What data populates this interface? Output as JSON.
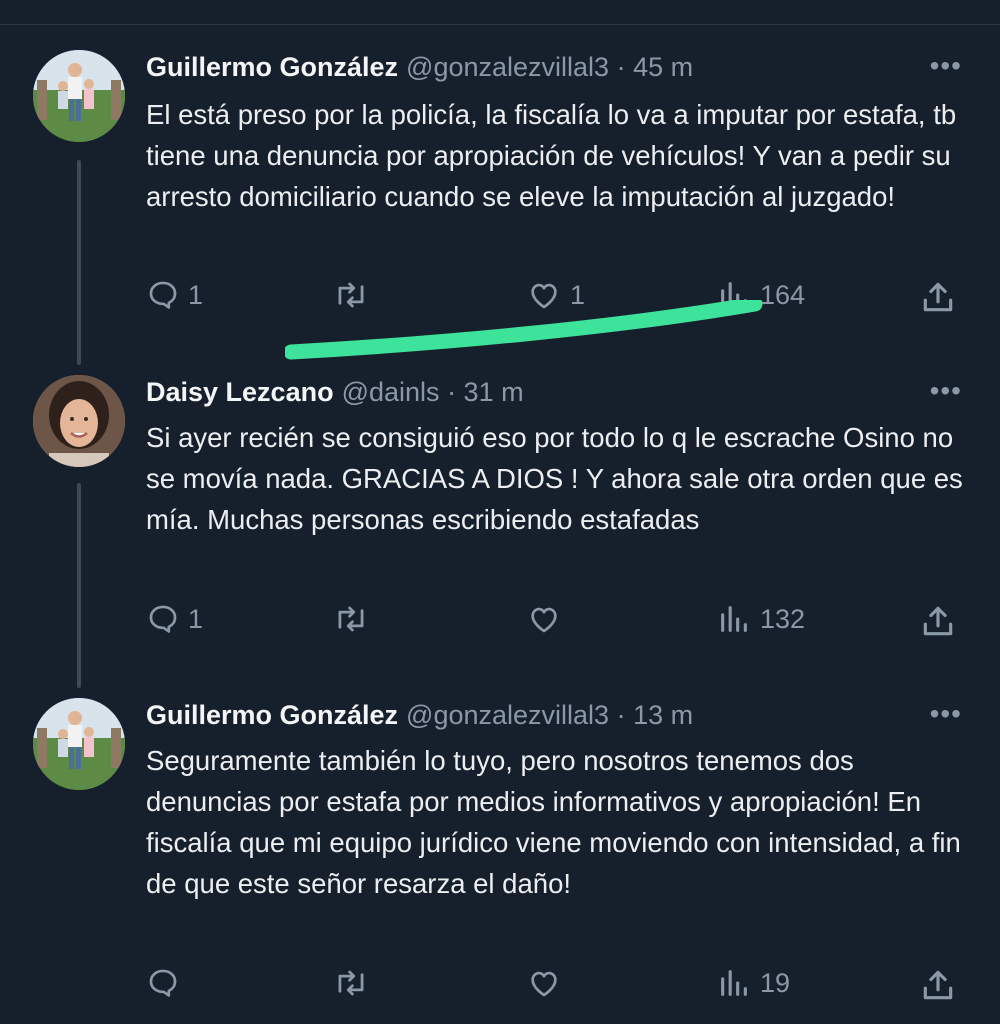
{
  "tweets": [
    {
      "author": "Guillermo González",
      "handle": "@gonzalezvillal3",
      "time": "· 45 m",
      "text": "El está preso por la policía, la fiscalía lo va a imputar por estafa, tb tiene una denuncia por apropiación de vehículos! Y van a pedir su arresto domiciliario cuando se eleve la imputación al juzgado!",
      "replies": "1",
      "retweets": "",
      "likes": "1",
      "views": "164"
    },
    {
      "author": "Daisy Lezcano",
      "handle": "@dainls",
      "time": "· 31 m",
      "text": "Si ayer recién se consiguió eso por todo lo q le escrache Osino no se movía nada. GRACIAS A DIOS ! Y ahora sale otra orden que es mía. Muchas personas escribiendo estafadas",
      "replies": "1",
      "retweets": "",
      "likes": "",
      "views": "132"
    },
    {
      "author": "Guillermo González",
      "handle": "@gonzalezvillal3",
      "time": "· 13 m",
      "text": "Seguramente también lo tuyo, pero nosotros tenemos dos denuncias por estafa por medios informativos y apropiación! En fiscalía que mi equipo jurídico viene moviendo con intensidad, a fin de que este señor resarza el daño!",
      "replies": "",
      "retweets": "",
      "likes": "",
      "views": "19"
    }
  ],
  "more_label": "•••",
  "colors": {
    "background": "#16202d",
    "muted": "#8b98a5",
    "text": "#e7e9ea",
    "highlight": "#3de39a"
  },
  "icons": [
    "reply-icon",
    "retweet-icon",
    "like-icon",
    "views-icon",
    "share-icon",
    "more-icon"
  ]
}
